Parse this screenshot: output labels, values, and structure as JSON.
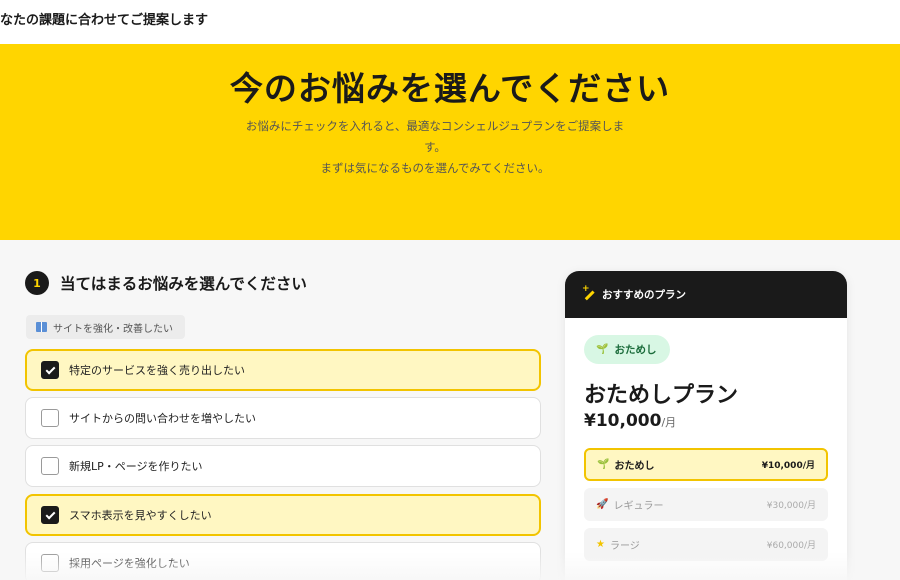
{
  "header": {
    "title": "なたの課題に合わせてご提案します"
  },
  "hero": {
    "title": "今のお悩みを選んでください",
    "desc_line1": "お悩みにチェックを入れると、最適なコンシェルジュプランをご提案しま",
    "desc_line2": "す。",
    "desc_line3": "まずは気になるものを選んでみてください。"
  },
  "step": {
    "number": "1",
    "title": "当てはまるお悩みを選んでください"
  },
  "category": {
    "label": "サイトを強化・改善したい",
    "icon": "book-icon"
  },
  "options": [
    {
      "label": "特定のサービスを強く売り出したい",
      "checked": true
    },
    {
      "label": "サイトからの問い合わせを増やしたい",
      "checked": false
    },
    {
      "label": "新規LP・ページを作りたい",
      "checked": false
    },
    {
      "label": "スマホ表示を見やすくしたい",
      "checked": true
    },
    {
      "label": "採用ページを強化したい",
      "checked": false
    }
  ],
  "plan": {
    "header_label": "おすすめのプラン",
    "badge": "おためし",
    "name": "おためしプラン",
    "price": "¥10,000",
    "price_unit": "/月",
    "tiers": [
      {
        "label": "おためし",
        "price": "¥10,000/月",
        "icon": "sprout-icon",
        "active": true
      },
      {
        "label": "レギュラー",
        "price": "¥30,000/月",
        "icon": "rocket-icon",
        "active": false
      },
      {
        "label": "ラージ",
        "price": "¥60,000/月",
        "icon": "star-icon",
        "active": false
      }
    ]
  },
  "colors": {
    "accent": "#ffd500",
    "dark": "#1a1a1a",
    "checked_bg": "#fff7c2",
    "checked_border": "#f2c400",
    "badge_bg": "#d8f7e4"
  }
}
